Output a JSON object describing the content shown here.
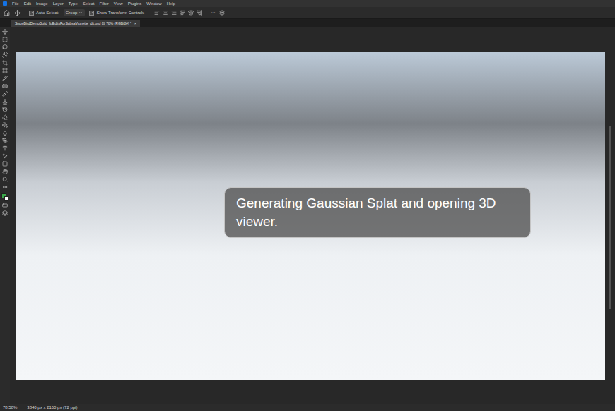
{
  "menu_bar": {
    "items": [
      "File",
      "Edit",
      "Image",
      "Layer",
      "Type",
      "Select",
      "Filter",
      "View",
      "Plugins",
      "Window",
      "Help"
    ]
  },
  "options_bar": {
    "auto_select": {
      "label": "Auto-Select:",
      "checked": true
    },
    "group": {
      "value": "Group"
    },
    "transform_controls": {
      "label": "Show Transform Controls",
      "checked": true
    },
    "more": "•••"
  },
  "document_tab": {
    "title": "SnowBirdDemoBuild_fpEditsForSabsaVignette_dit.psd @ 78% (RGB/8#) *",
    "close": "×"
  },
  "overlay": {
    "message": "Generating Gaussian Splat and opening 3D viewer."
  },
  "status_bar": {
    "zoom": "78.58%",
    "info": "3840 px x 2160 px (72 ppi)"
  }
}
